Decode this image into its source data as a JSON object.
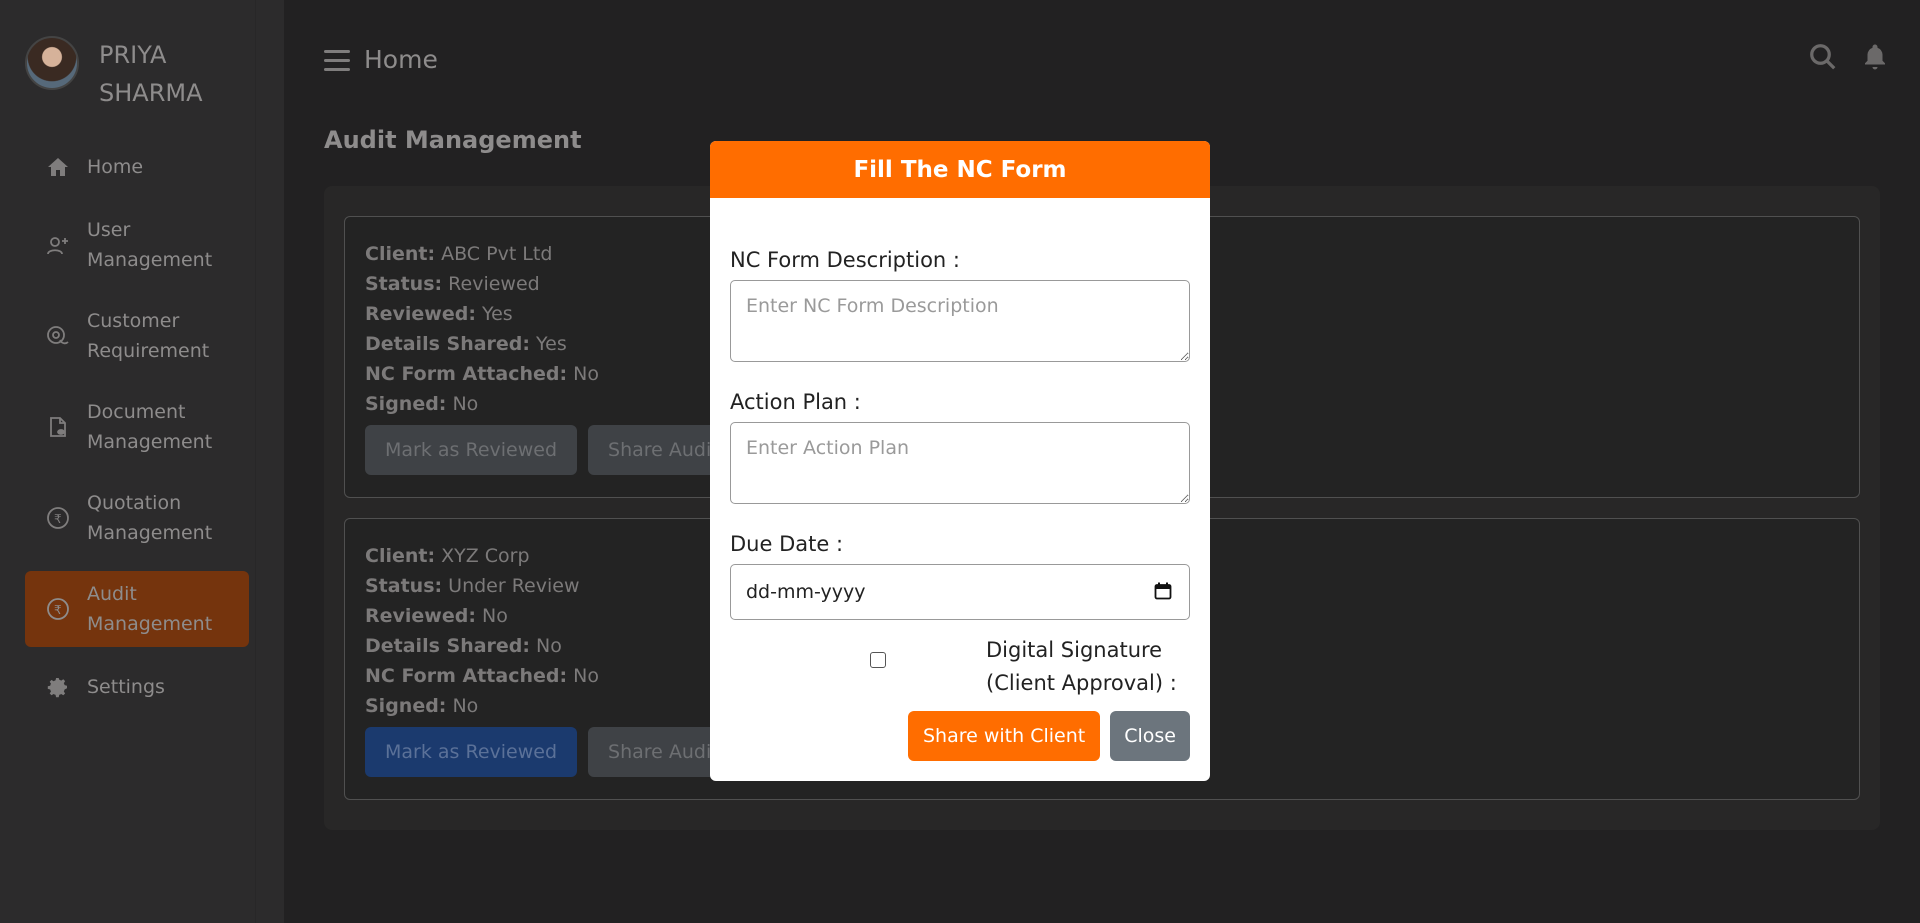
{
  "user": {
    "name": "PRIYA SHARMA"
  },
  "header": {
    "title": "Home"
  },
  "page": {
    "section_title": "Audit Management"
  },
  "sidebar": {
    "items": [
      {
        "label": "Home",
        "icon": "home-icon"
      },
      {
        "label": "User Management",
        "icon": "user-add-icon"
      },
      {
        "label": "Customer Requirement",
        "icon": "chat-icon"
      },
      {
        "label": "Document Management",
        "icon": "document-icon"
      },
      {
        "label": "Quotation Management",
        "icon": "quotation-icon"
      },
      {
        "label": "Audit Management",
        "icon": "audit-icon",
        "active": true
      },
      {
        "label": "Settings",
        "icon": "gear-icon"
      }
    ]
  },
  "labels": {
    "client": "Client:",
    "status": "Status:",
    "reviewed": "Reviewed:",
    "details_shared": "Details Shared:",
    "nc_form_attached": "NC Form Attached:",
    "signed": "Signed:"
  },
  "audits": [
    {
      "client": "ABC Pvt Ltd",
      "status": "Reviewed",
      "reviewed": "Yes",
      "details_shared": "Yes",
      "nc_form_attached": "No",
      "signed": "No",
      "mark_reviewed_label": "Mark as Reviewed",
      "share_audit_label": "Share Audit"
    },
    {
      "client": "XYZ Corp",
      "status": "Under Review",
      "reviewed": "No",
      "details_shared": "No",
      "nc_form_attached": "No",
      "signed": "No",
      "mark_reviewed_label": "Mark as Reviewed",
      "share_audit_label": "Share Audit"
    }
  ],
  "modal": {
    "title": "Fill The NC Form",
    "description_label": "NC Form Description :",
    "description_placeholder": "Enter NC Form Description",
    "action_plan_label": "Action Plan :",
    "action_plan_placeholder": "Enter Action Plan",
    "due_date_label": "Due Date :",
    "due_date_placeholder": "dd-mm-yyyy",
    "signature_label": "Digital Signature (Client Approval) :",
    "share_button": "Share with Client",
    "close_button": "Close"
  },
  "colors": {
    "accent": "#ff6d00",
    "active_nav": "#75340d",
    "close_button": "#6c757d"
  }
}
